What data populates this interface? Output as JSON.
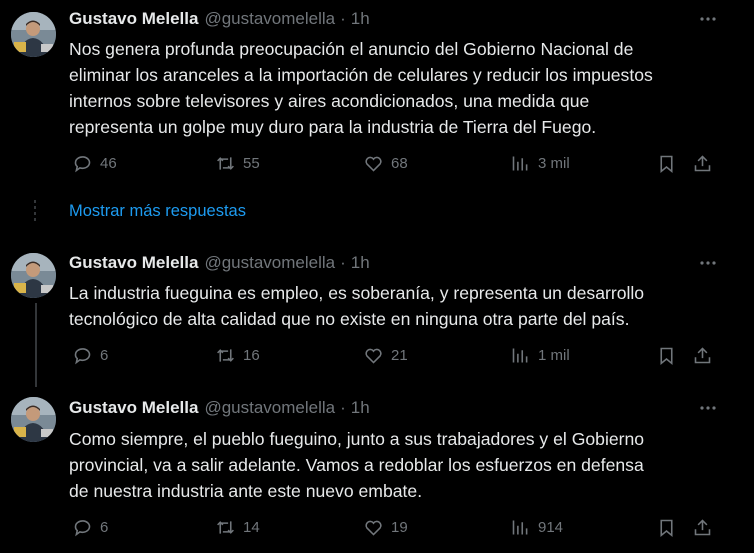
{
  "tweets": [
    {
      "name": "Gustavo Melella",
      "handle": "@gustavomelella",
      "time": "1h",
      "lines": [
        "Nos genera profunda preocupación el anuncio del Gobierno Nacional de",
        "eliminar los aranceles a la importación de celulares y reducir los impuestos",
        "internos sobre televisores y aires acondicionados, una medida que",
        "representa un golpe muy duro para la industria de Tierra del Fuego."
      ],
      "replies": "46",
      "reposts": "55",
      "likes": "68",
      "views": "3 mil"
    },
    {
      "name": "Gustavo Melella",
      "handle": "@gustavomelella",
      "time": "1h",
      "lines": [
        "La industria fueguina es empleo, es soberanía, y representa un desarrollo",
        "tecnológico de alta calidad que no existe en ninguna otra parte del país."
      ],
      "replies": "6",
      "reposts": "16",
      "likes": "21",
      "views": "1 mil"
    },
    {
      "name": "Gustavo Melella",
      "handle": "@gustavomelella",
      "time": "1h",
      "lines": [
        "Como siempre, el pueblo fueguino, junto a sus trabajadores y el Gobierno",
        "provincial, va a salir adelante. Vamos a redoblar los esfuerzos en defensa",
        "de nuestra industria ante este nuevo embate."
      ],
      "replies": "6",
      "reposts": "14",
      "likes": "19",
      "views": "914"
    }
  ],
  "show_more_label": "Mostrar más respuestas",
  "separator_dot": "·",
  "colors": {
    "background": "#000000",
    "text": "#e7e9ea",
    "muted": "#71767b",
    "link": "#1d9bf0"
  },
  "icons": [
    "reply-icon",
    "repost-icon",
    "like-icon",
    "views-icon",
    "bookmark-icon",
    "share-icon",
    "more-icon"
  ]
}
